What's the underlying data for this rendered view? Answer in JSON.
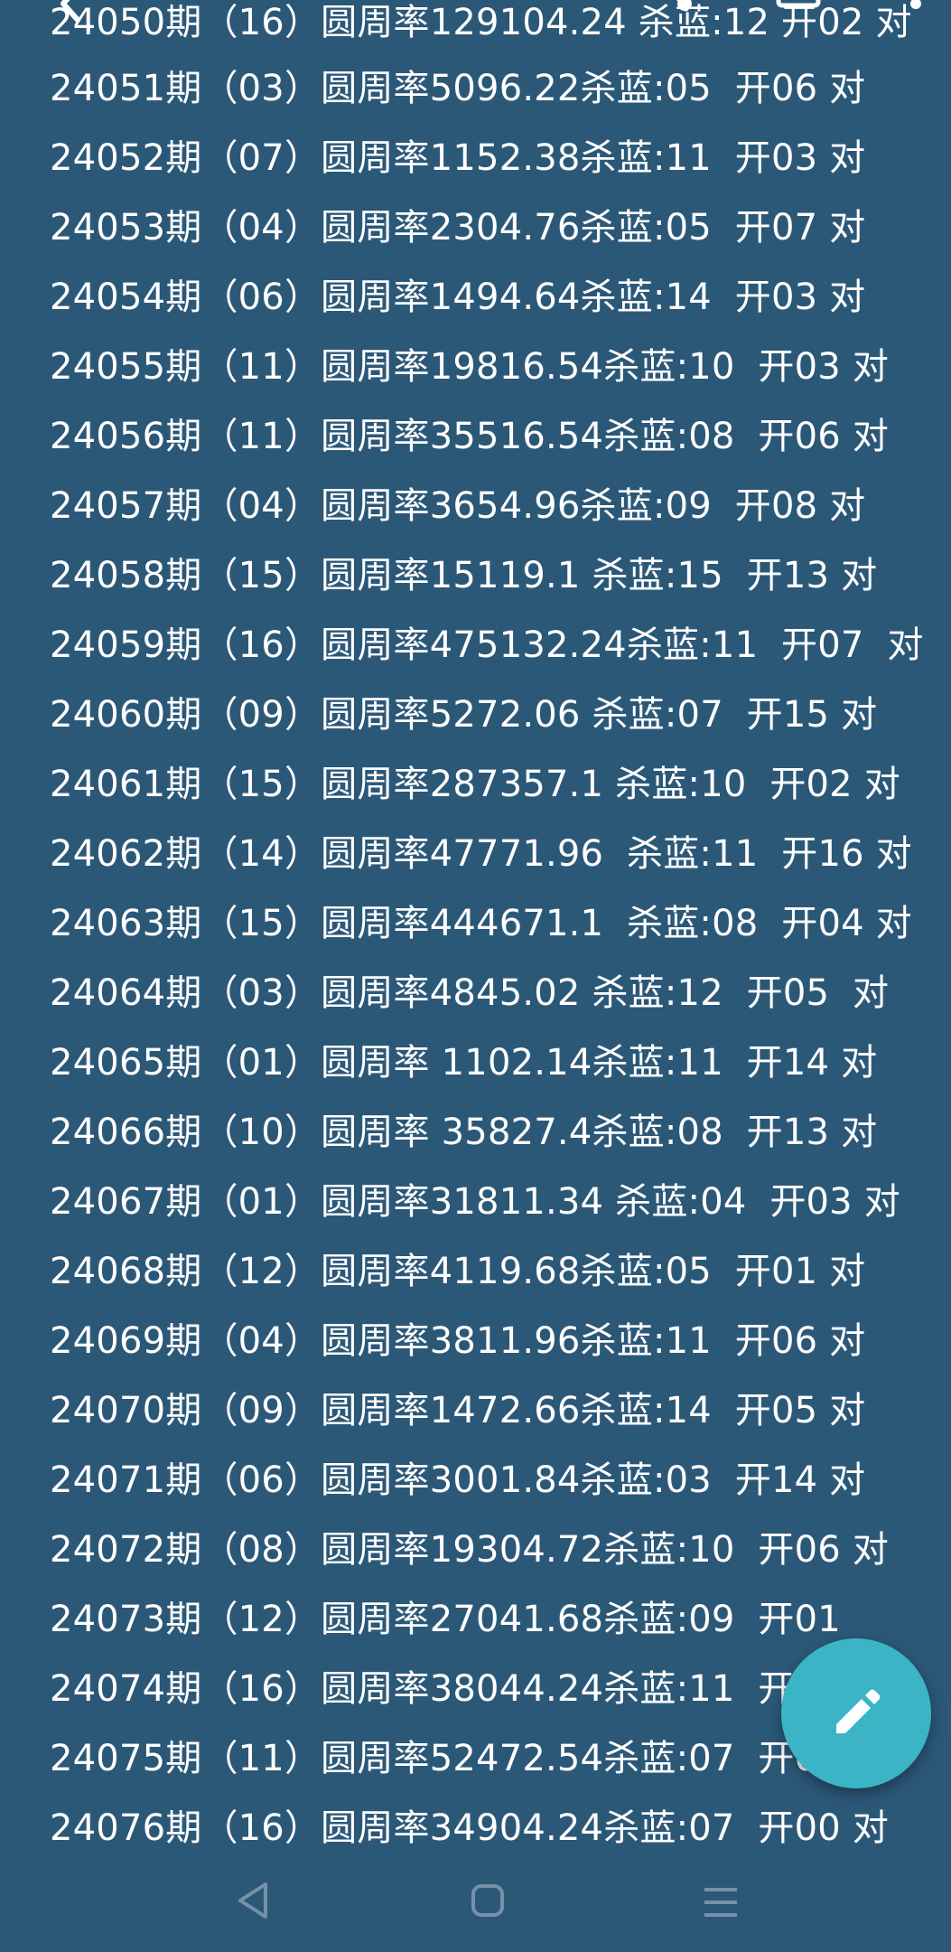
{
  "lines": [
    "24050期（16）圆周率129104.24 杀蓝:12 开02 对",
    "24051期（03）圆周率5096.22杀蓝:05  开06 对",
    "24052期（07）圆周率1152.38杀蓝:11  开03 对",
    "24053期（04）圆周率2304.76杀蓝:05  开07 对",
    "24054期（06）圆周率1494.64杀蓝:14  开03 对",
    "24055期（11）圆周率19816.54杀蓝:10  开03 对",
    "24056期（11）圆周率35516.54杀蓝:08  开06 对",
    "24057期（04）圆周率3654.96杀蓝:09  开08 对",
    "24058期（15）圆周率15119.1 杀蓝:15  开13 对",
    "24059期（16）圆周率475132.24杀蓝:11  开07  对",
    "24060期（09）圆周率5272.06 杀蓝:07  开15 对",
    "24061期（15）圆周率287357.1 杀蓝:10  开02 对",
    "24062期（14）圆周率47771.96  杀蓝:11  开16 对",
    "24063期（15）圆周率444671.1  杀蓝:08  开04 对",
    "24064期（03）圆周率4845.02 杀蓝:12  开05  对",
    "24065期（01）圆周率 1102.14杀蓝:11  开14 对",
    "24066期（10）圆周率 35827.4杀蓝:08  开13 对",
    "24067期（01）圆周率31811.34 杀蓝:04  开03 对",
    "24068期（12）圆周率4119.68杀蓝:05  开01 对",
    "24069期（04）圆周率3811.96杀蓝:11  开06 对",
    "24070期（09）圆周率1472.66杀蓝:14  开05 对",
    "24071期（06）圆周率3001.84杀蓝:03  开14 对",
    "24072期（08）圆周率19304.72杀蓝:10  开06 对",
    "24073期（12）圆周率27041.68杀蓝:09  开01",
    "24074期（16）圆周率38044.24杀蓝:11  开0",
    "24075期（11）圆周率52472.54杀蓝:07  开01 对",
    "24076期（16）圆周率34904.24杀蓝:07  开00 对"
  ],
  "icons": {
    "back": "back-arrow-icon",
    "share": "share-icon",
    "copy": "copy-icon",
    "more": "more-vert-icon",
    "fab": "edit-pencil-icon",
    "nav_back": "nav-back-icon",
    "nav_home": "nav-home-icon",
    "nav_recents": "nav-recents-icon"
  },
  "colors": {
    "background": "#2c5878",
    "fab": "#3bb4c6",
    "text": "#ffffff"
  }
}
